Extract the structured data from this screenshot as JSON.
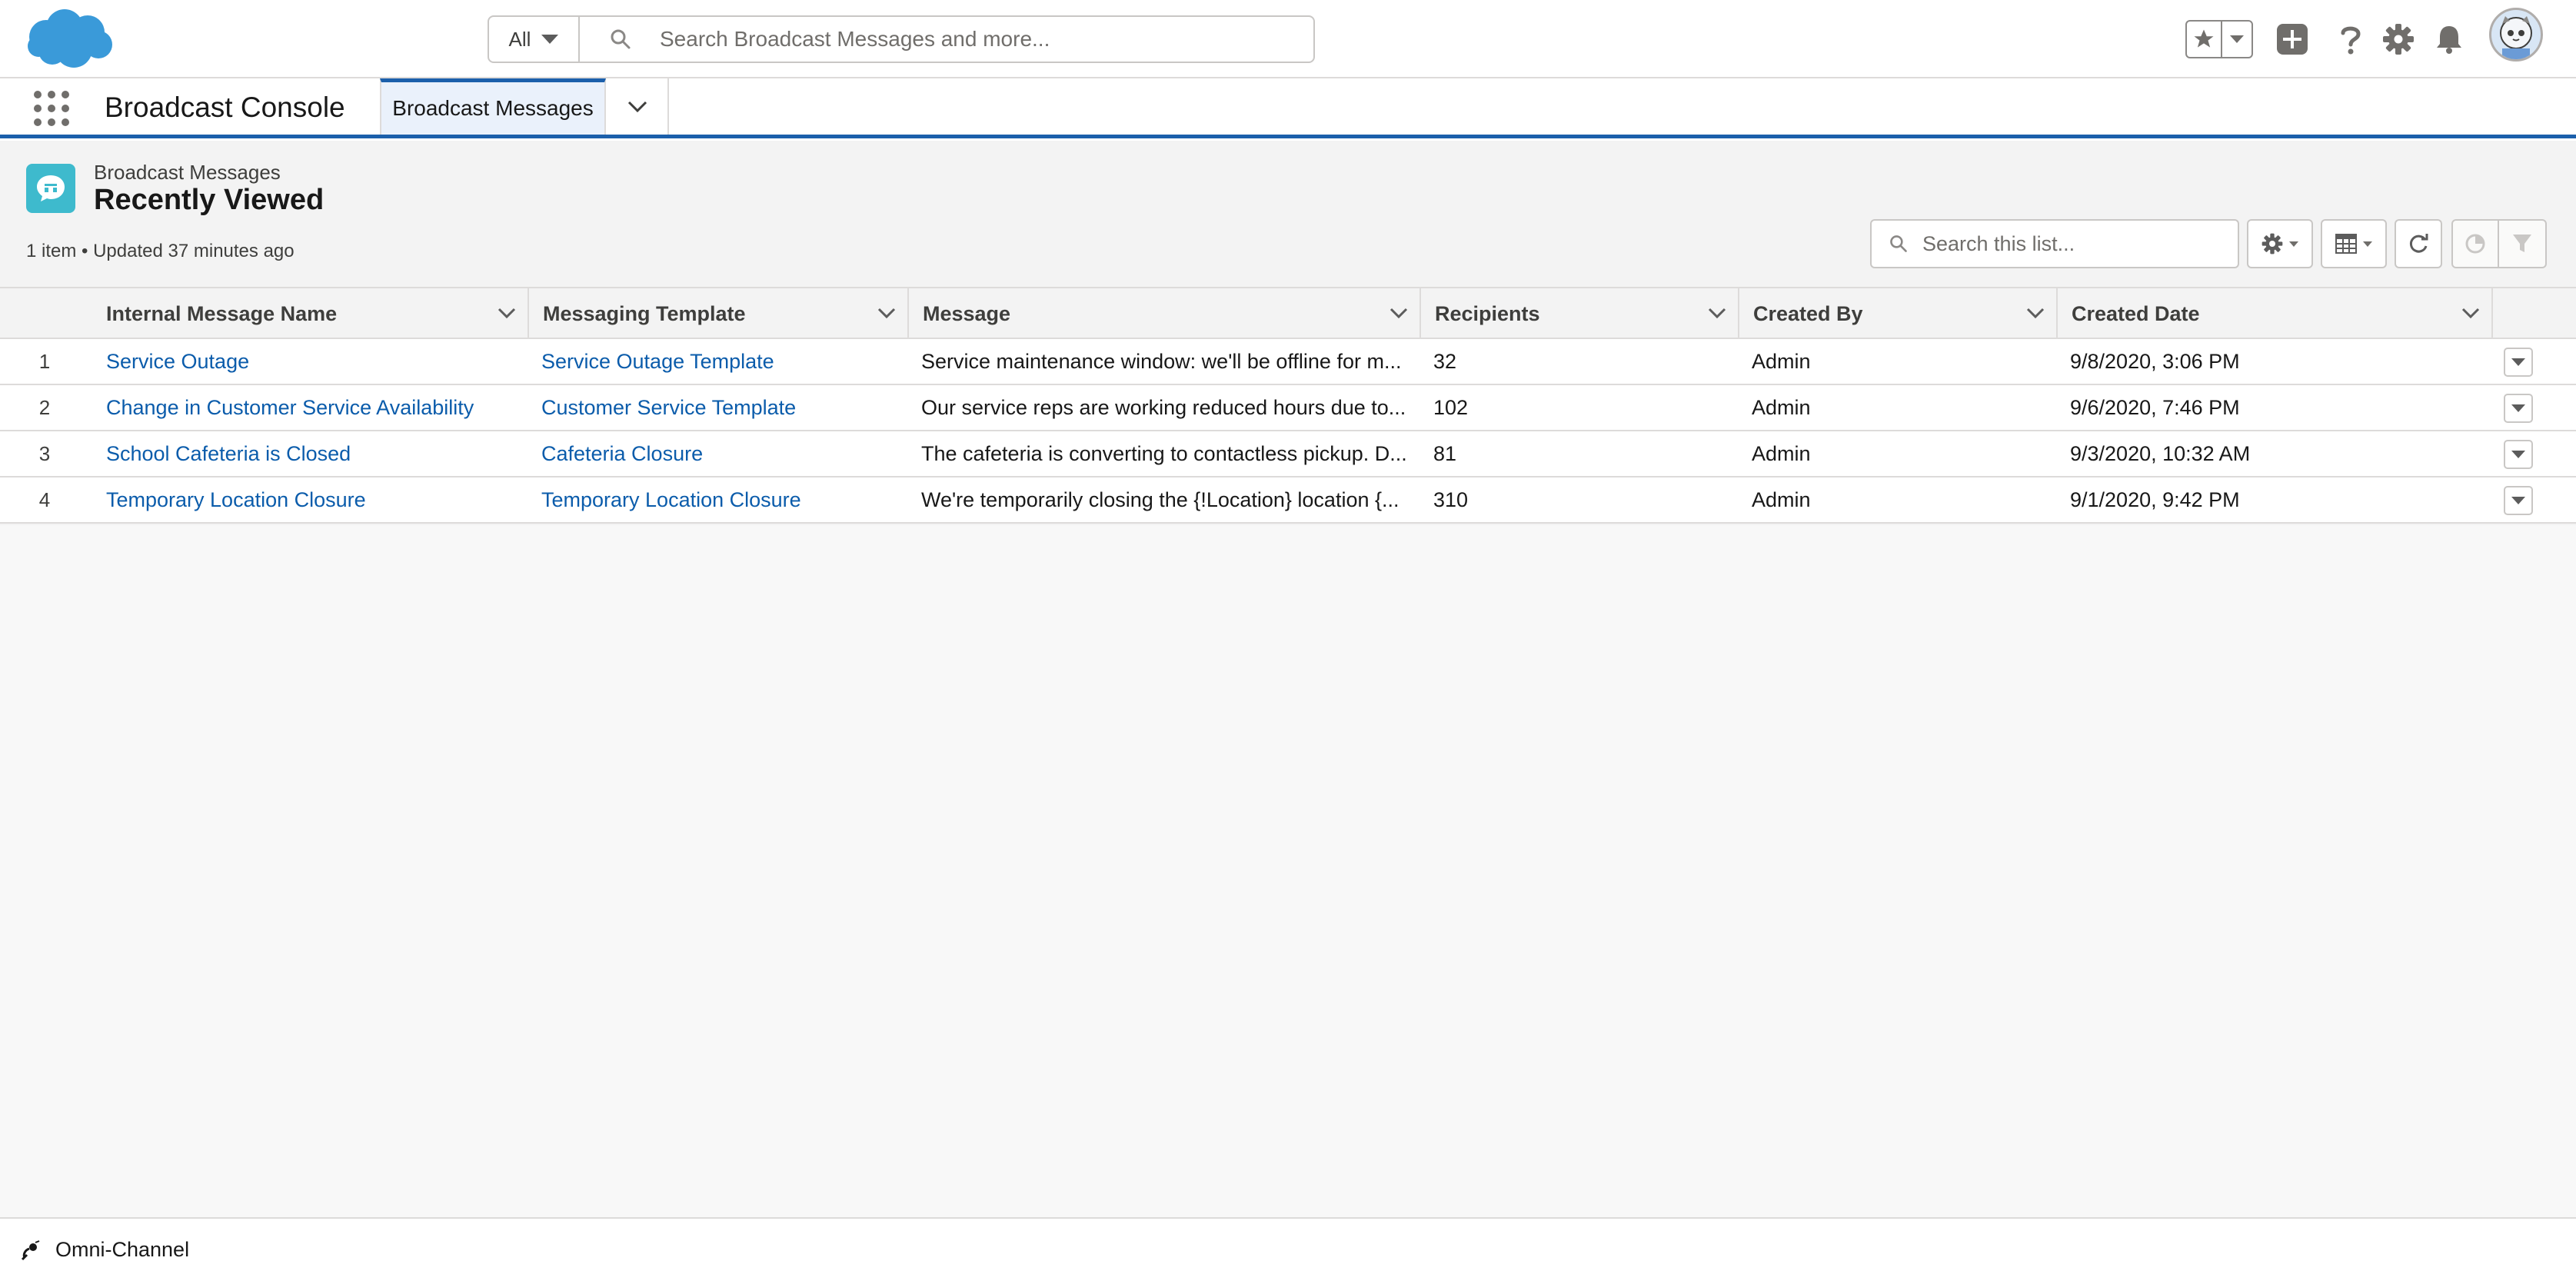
{
  "header": {
    "search_scope": "All",
    "search_placeholder": "Search Broadcast Messages and more...",
    "icons": [
      "favorites-star-icon",
      "add-icon",
      "help-icon",
      "setup-gear-icon",
      "notifications-bell-icon",
      "user-avatar"
    ]
  },
  "nav": {
    "app_name": "Broadcast Console",
    "active_tab": "Broadcast Messages"
  },
  "list_view": {
    "object_label": "Broadcast Messages",
    "view_name": "Recently Viewed",
    "meta": "1 item • Updated 37 minutes ago",
    "search_placeholder": "Search this list..."
  },
  "table": {
    "columns": [
      "Internal Message Name",
      "Messaging Template",
      "Message",
      "Recipients",
      "Created By",
      "Created Date"
    ],
    "rows": [
      {
        "num": "1",
        "name": "Service Outage",
        "template": "Service Outage Template",
        "message": "Service maintenance window: we'll be offline for m...",
        "recipients": "32",
        "created_by": "Admin",
        "created_date": "9/8/2020, 3:06 PM"
      },
      {
        "num": "2",
        "name": "Change in Customer Service Availability",
        "template": "Customer Service Template",
        "message": "Our service reps are working reduced hours due to...",
        "recipients": "102",
        "created_by": "Admin",
        "created_date": "9/6/2020, 7:46 PM"
      },
      {
        "num": "3",
        "name": "School Cafeteria is Closed",
        "template": "Cafeteria Closure",
        "message": "The cafeteria is converting to contactless pickup. D...",
        "recipients": "81",
        "created_by": "Admin",
        "created_date": "9/3/2020, 10:32 AM"
      },
      {
        "num": "4",
        "name": "Temporary Location Closure",
        "template": "Temporary Location Closure",
        "message": "We're temporarily closing the {!Location} location {...",
        "recipients": "310",
        "created_by": "Admin",
        "created_date": "9/1/2020, 9:42 PM"
      }
    ]
  },
  "utility_bar": {
    "omni_channel_label": "Omni-Channel"
  },
  "colors": {
    "brand_blue": "#1b5fab",
    "link_blue": "#0b5cab",
    "object_icon": "#3ebacd",
    "cloud": "#3a9ad9"
  }
}
